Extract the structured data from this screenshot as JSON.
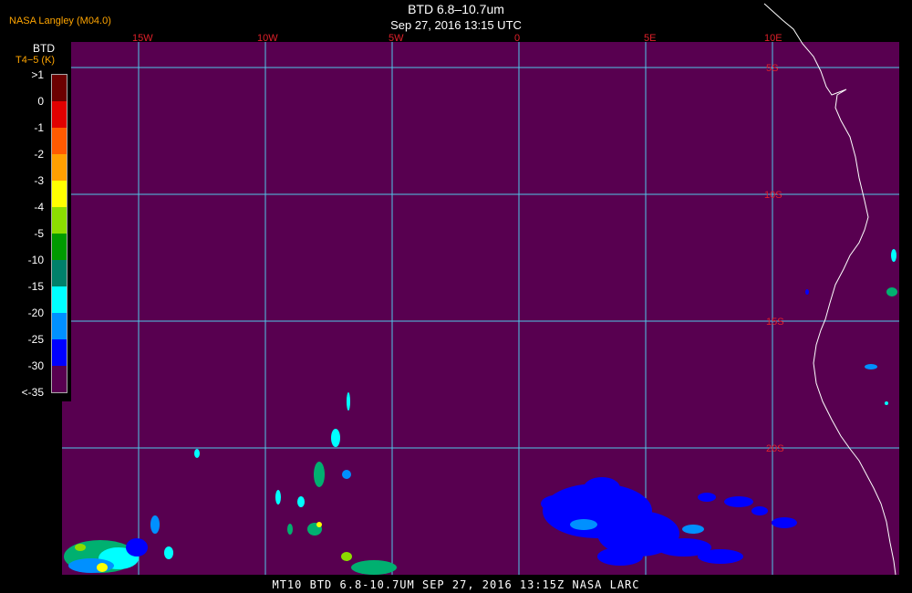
{
  "header": {
    "top_left": "NASA Langley (M04.0)",
    "title": "BTD 6.8–10.7um",
    "subtitle": "Sep 27, 2016 13:15 UTC"
  },
  "footer": {
    "text": "MT10  BTD 6.8-10.7UM  SEP 27, 2016 13:15Z  NASA LARC"
  },
  "legend": {
    "title": "BTD",
    "subtitle": "T4−5 (K)",
    "labels": [
      ">1",
      "0",
      "-1",
      "-2",
      "-3",
      "-4",
      "-5",
      "-10",
      "-15",
      "-20",
      "-25",
      "-30",
      "<-35"
    ],
    "colors": [
      "#6b0000",
      "#e00000",
      "#ff5a00",
      "#ff9f00",
      "#ffff00",
      "#8cdc00",
      "#009a00",
      "#00806a",
      "#00ffff",
      "#0090ff",
      "#0000ff",
      "#000090",
      "#580050"
    ]
  },
  "map": {
    "background_color": "#580050",
    "grid_color": "#4fc8e8",
    "longitude_labels": [
      "15W",
      "10W",
      "5W",
      "0",
      "5E",
      "10E"
    ],
    "latitude_labels": [
      "5S",
      "10S",
      "15S",
      "20S"
    ],
    "label_color": "#e0202a"
  }
}
